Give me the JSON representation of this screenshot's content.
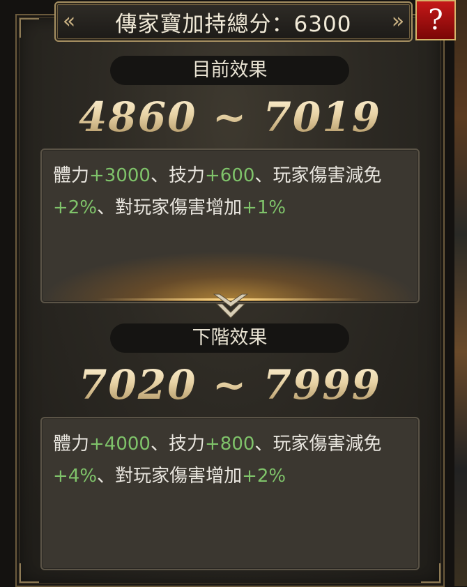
{
  "header": {
    "title_label": "傳家寶加持總分",
    "title_separator": "：",
    "score": "6300",
    "help_label": "?"
  },
  "current": {
    "section_label": "目前效果",
    "range_min": "4860",
    "range_sep": "~",
    "range_max": "7019",
    "effects": [
      {
        "name": "體力",
        "value": "+3000"
      },
      {
        "name": "技力",
        "value": "+600"
      },
      {
        "name": "玩家傷害減免",
        "value": "+2%"
      },
      {
        "name": "對玩家傷害增加",
        "value": "+1%"
      }
    ]
  },
  "next": {
    "section_label": "下階效果",
    "range_min": "7020",
    "range_sep": "~",
    "range_max": "7999",
    "effects": [
      {
        "name": "體力",
        "value": "+4000"
      },
      {
        "name": "技力",
        "value": "+800"
      },
      {
        "name": "玩家傷害減免",
        "value": "+4%"
      },
      {
        "name": "對玩家傷害增加",
        "value": "+2%"
      }
    ]
  },
  "separator": "、",
  "colors": {
    "bonus_green": "#7fc36a",
    "gold_text": "#e8d3a6",
    "help_red": "#c41818"
  },
  "icons": {
    "title_left": "double-chevron-left-icon",
    "title_right": "double-chevron-right-icon",
    "divider": "double-chevron-down-icon"
  }
}
